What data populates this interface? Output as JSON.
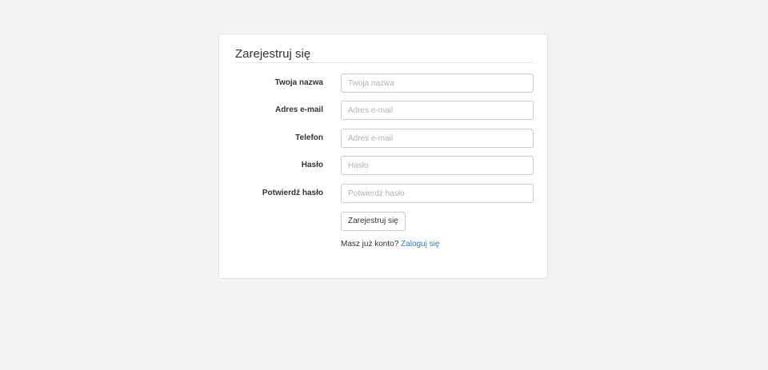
{
  "form": {
    "title": "Zarejestruj się",
    "fields": [
      {
        "label": "Twoja nazwa",
        "placeholder": "Twoja nazwa",
        "value": ""
      },
      {
        "label": "Adres e-mail",
        "placeholder": "Adres e-mail",
        "value": ""
      },
      {
        "label": "Telefon",
        "placeholder": "Adres e-mail",
        "value": ""
      },
      {
        "label": "Hasło",
        "placeholder": "Hasło",
        "value": ""
      },
      {
        "label": "Potwierdź hasło",
        "placeholder": "Potwierdź hasło",
        "value": ""
      }
    ],
    "submit_label": "Zarejestruj się",
    "login_prompt": "Masz już konto?",
    "login_link": "Zaloguj się"
  },
  "colors": {
    "background": "#f3f3f3",
    "panel": "#ffffff",
    "link": "#337ab7"
  }
}
